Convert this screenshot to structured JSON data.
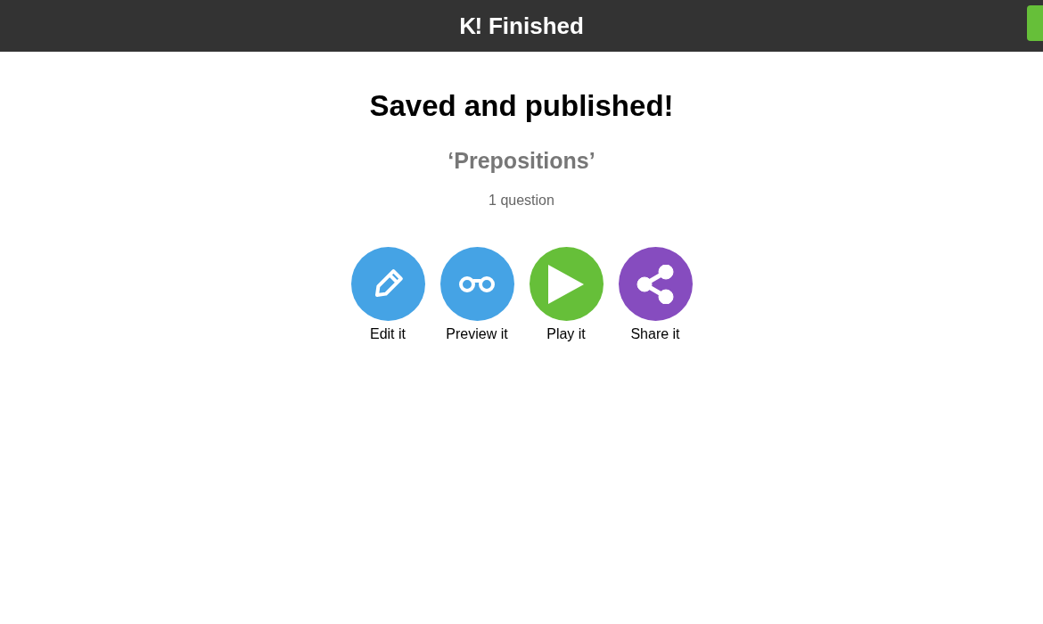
{
  "header": {
    "logo": "K!",
    "title": "Finished"
  },
  "heading": "Saved and published!",
  "kahoot_title": "‘Prepositions’",
  "question_count": "1 question",
  "actions": [
    {
      "kind": "edit",
      "label": "Edit it",
      "color": "#45a3e5"
    },
    {
      "kind": "preview",
      "label": "Preview it",
      "color": "#45a3e5"
    },
    {
      "kind": "play",
      "label": "Play it",
      "color": "#66bf39"
    },
    {
      "kind": "share",
      "label": "Share it",
      "color": "#864cbf"
    }
  ]
}
